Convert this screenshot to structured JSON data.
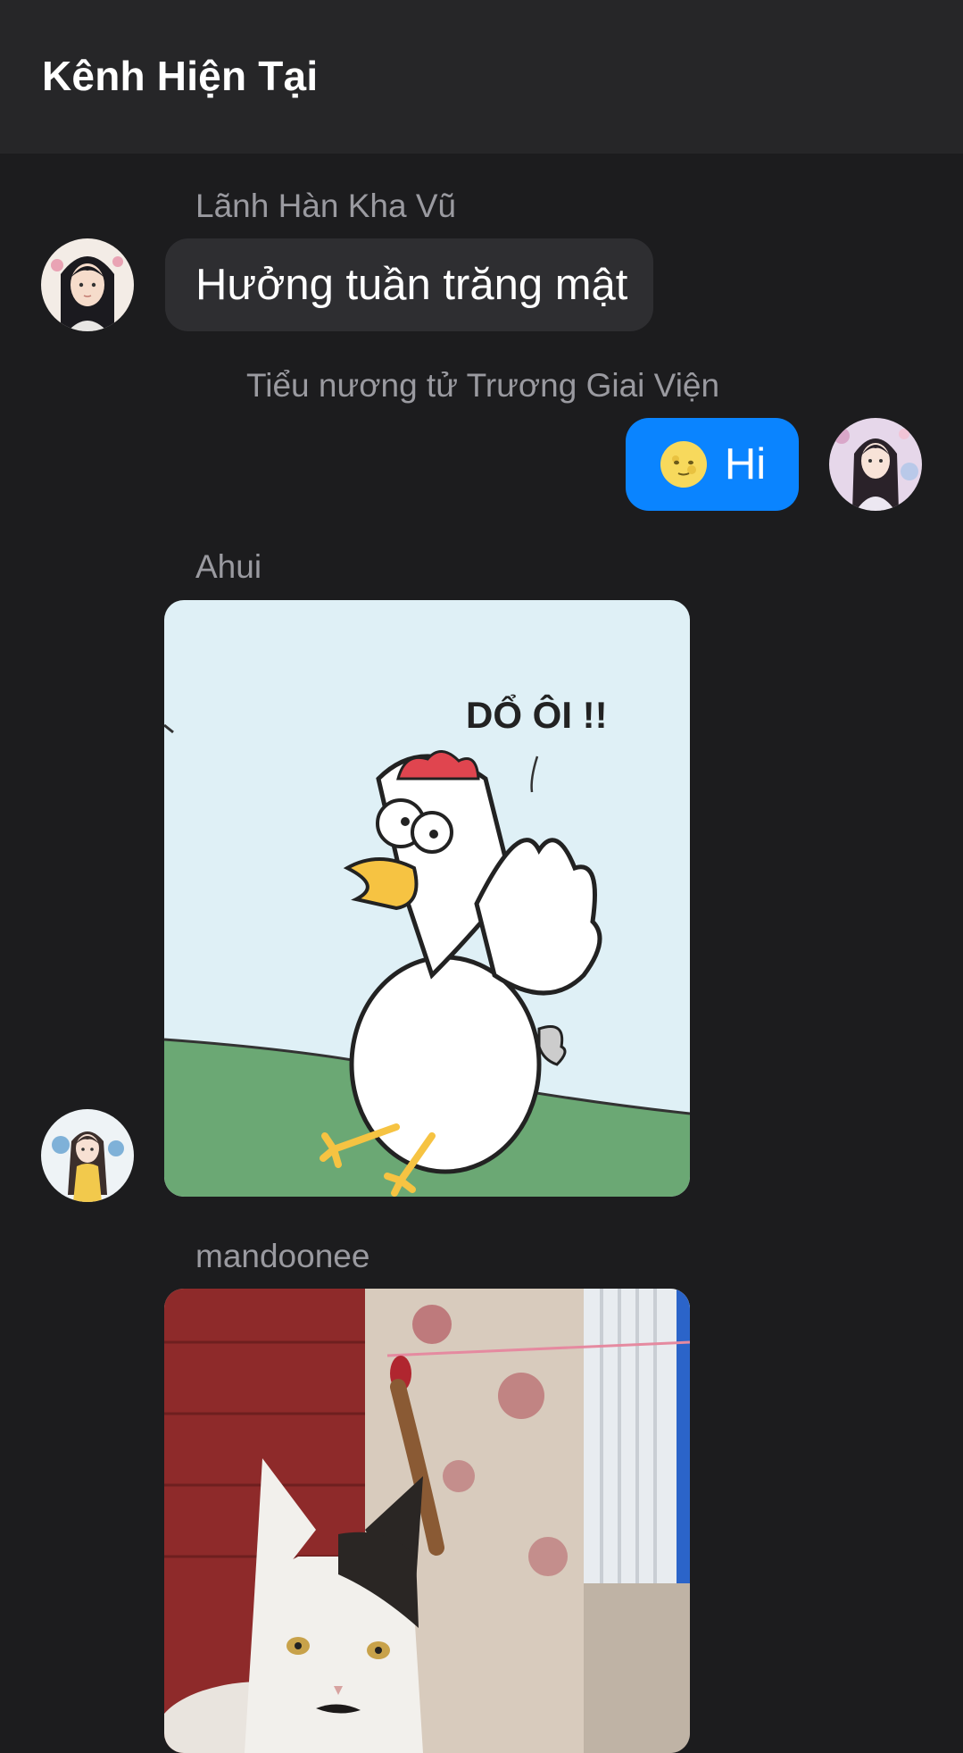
{
  "header": {
    "title": "Kênh Hiện Tại"
  },
  "messages": [
    {
      "sender": "Lãnh Hàn Kha Vũ",
      "text": "Hưởng tuần trăng mật",
      "avatar_icon": "avatar-long-hair-man-icon"
    },
    {
      "sender": "Tiểu nương tử Trương Giai Viện",
      "text": "Hi",
      "emoji_icon": "moon-face-icon",
      "avatar_icon": "avatar-woman-flowers-icon"
    },
    {
      "sender": "Ahui",
      "image": {
        "caption_text": "DỔ ÔI !!",
        "subject": "screaming-chicken-sticker"
      },
      "avatar_icon": "avatar-girl-yellow-dress-icon"
    },
    {
      "sender": "mandoonee",
      "image": {
        "subject": "cat-photo"
      }
    }
  ],
  "colors": {
    "background": "#1c1c1e",
    "header": "#262628",
    "incoming_bubble": "#2e2e31",
    "outgoing_bubble": "#0a84ff",
    "sender_text": "#9a9aa0"
  }
}
